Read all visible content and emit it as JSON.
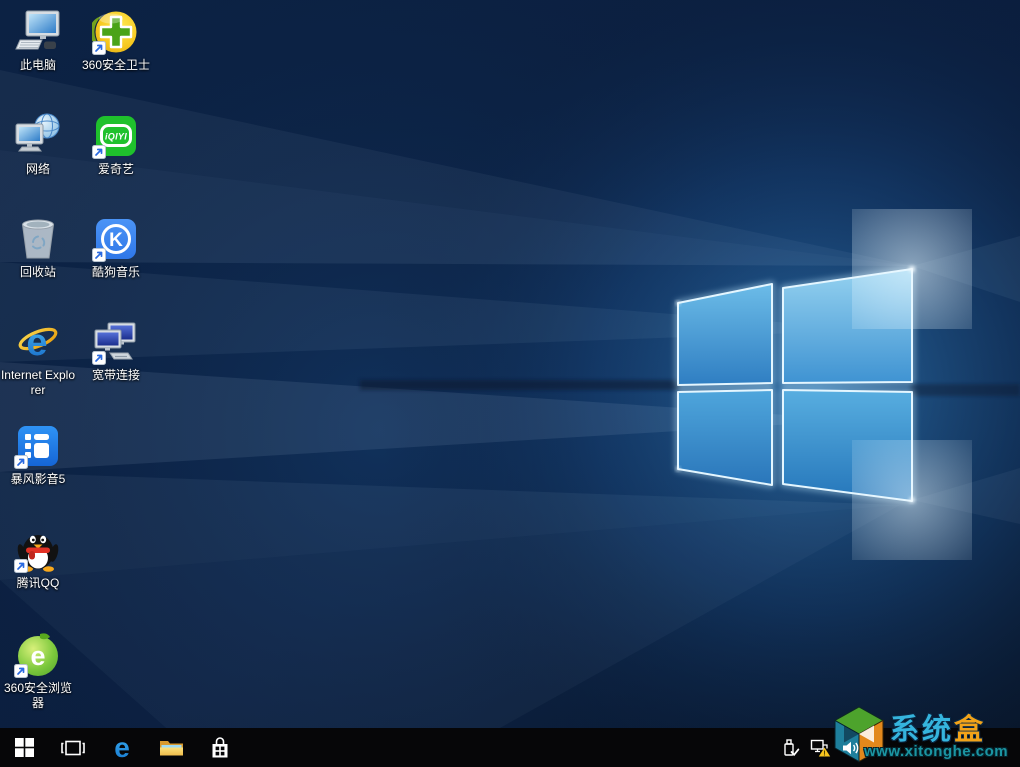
{
  "meta": {
    "os_name": "Windows 10 desktop",
    "locale": "zh-CN"
  },
  "desktop": {
    "icons": [
      {
        "label": "此电脑",
        "shortcut": false
      },
      {
        "label": "网络",
        "shortcut": false
      },
      {
        "label": "回收站",
        "shortcut": false
      },
      {
        "label": "Internet Explorer",
        "shortcut": false
      },
      {
        "label": "暴风影音5",
        "shortcut": true
      },
      {
        "label": "腾讯QQ",
        "shortcut": true
      },
      {
        "label": "360安全浏览器",
        "shortcut": true
      },
      {
        "label": "360安全卫士",
        "shortcut": true
      },
      {
        "label": "爱奇艺",
        "shortcut": true
      },
      {
        "label": "酷狗音乐",
        "shortcut": true
      },
      {
        "label": "宽带连接",
        "shortcut": true
      }
    ]
  },
  "icon_glyphs": {
    "iqiyi": "iQIYI",
    "kugou": "K",
    "ie": "e",
    "edge": "e",
    "browser360": "e"
  },
  "taskbar": {
    "buttons": [
      {
        "id": "start",
        "icon": "windows-logo"
      },
      {
        "id": "task-view",
        "icon": "task-view-frames"
      },
      {
        "id": "edge",
        "icon": "edge-e"
      },
      {
        "id": "file-explorer",
        "icon": "yellow-folder"
      },
      {
        "id": "store",
        "icon": "store-bag"
      }
    ],
    "tray": [
      {
        "id": "usb-safely-remove",
        "icon": "usb-check"
      },
      {
        "id": "network-warning",
        "icon": "ethernet-warning"
      },
      {
        "id": "volume",
        "icon": "speaker-waves"
      }
    ]
  },
  "watermark": {
    "title_main": "系统",
    "title_accent": "盒",
    "url": "www.xitonghe.com"
  },
  "colors": {
    "taskbar": "#060608",
    "wallpaper_deep": "#0a1b38",
    "wallpaper_glow": "#2f86c8",
    "warning_yellow": "#f7c51e",
    "watermark_teal": "#1b95a2",
    "watermark_orange": "#f2a319"
  }
}
